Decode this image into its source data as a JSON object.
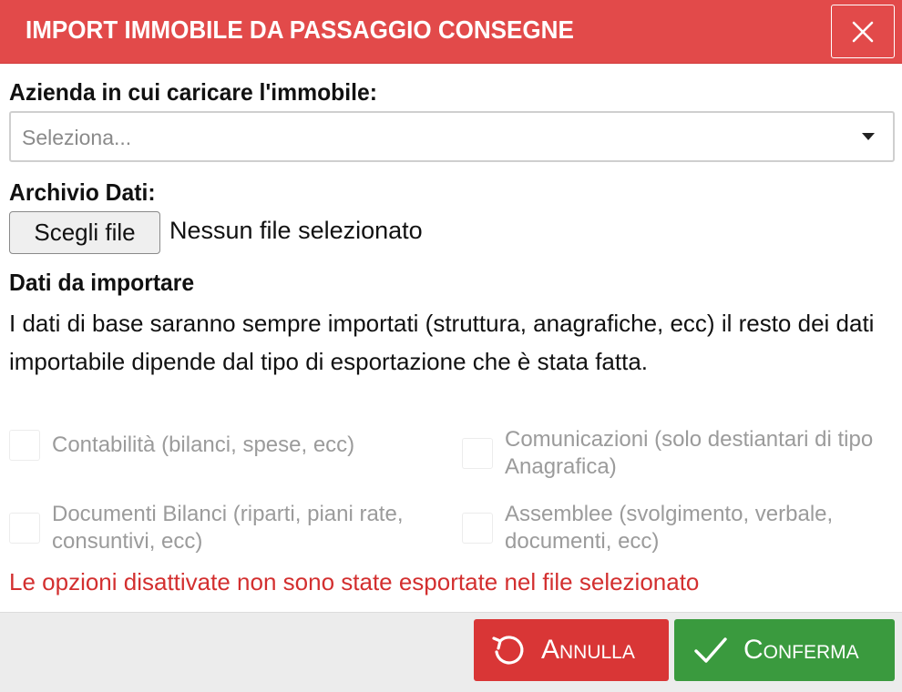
{
  "dialog": {
    "title": "IMPORT IMMOBILE DA PASSAGGIO CONSEGNE",
    "close_icon": "close-icon"
  },
  "company": {
    "label": "Azienda in cui caricare l'immobile:",
    "placeholder": "Seleziona..."
  },
  "archive": {
    "label": "Archivio Dati:",
    "button": "Scegli file",
    "status": "Nessun file selezionato"
  },
  "import": {
    "title": "Dati da importare",
    "description": "I dati di base saranno sempre importati (struttura, anagrafiche, ecc) il resto dei dati importabile dipende dal tipo di esportazione che è stata fatta.",
    "options": [
      {
        "label": "Contabilità (bilanci, spese, ecc)",
        "checked": false,
        "disabled": true
      },
      {
        "label": "Comunicazioni (solo destiantari di tipo Anagrafica)",
        "checked": false,
        "disabled": true
      },
      {
        "label": "Documenti Bilanci (riparti, piani rate, consuntivi, ecc)",
        "checked": false,
        "disabled": true
      },
      {
        "label": "Assemblee (svolgimento, verbale, documenti, ecc)",
        "checked": false,
        "disabled": true
      }
    ],
    "warning": "Le opzioni disattivate non sono state esportate nel file selezionato"
  },
  "footer": {
    "cancel_label": "Annulla",
    "confirm_label": "Conferma"
  },
  "colors": {
    "header": "#e24a4a",
    "cancel": "#d93636",
    "confirm": "#3a9a3e",
    "warning": "#d32f2f"
  }
}
